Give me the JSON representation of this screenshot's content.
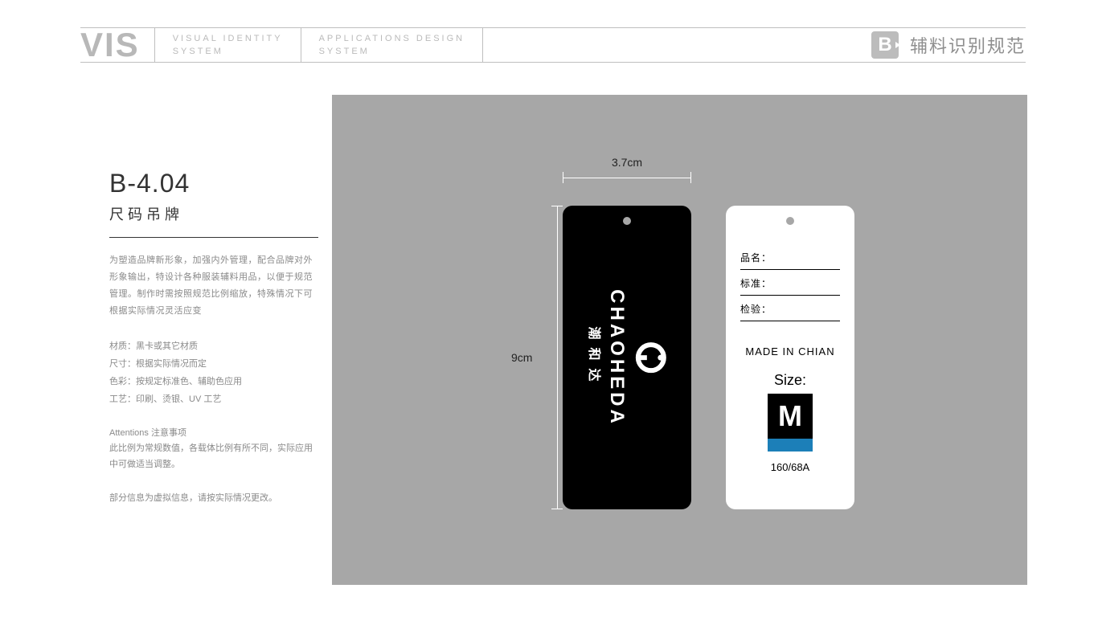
{
  "header": {
    "vis": "VIS",
    "block1_l1": "VISUAL IDENTITY",
    "block1_l2": "SYSTEM",
    "block2_l1": "APPLICATIONS DESIGN",
    "block2_l2": "SYSTEM",
    "badge": "B",
    "section": "辅料识别规范"
  },
  "left": {
    "code": "B-4.04",
    "title": "尺码吊牌",
    "intro": "为塑造品牌新形象，加强内外管理，配合品牌对外形象输出，特设计各种服装辅料用品，以便于规范管理。制作时需按照规范比例缩放，特殊情况下可根据实际情况灵活应变",
    "specs": {
      "material": "材质：黑卡或其它材质",
      "size": "尺寸：根据实际情况而定",
      "color": "色彩：按规定标准色、辅助色应用",
      "craft": "工艺：印刷、烫银、UV 工艺"
    },
    "notes_head": "Attentions 注意事项",
    "notes_body": "此比例为常规数值，各载体比例有所不同，实际应用中可做适当调整。",
    "footnote": "部分信息为虚拟信息，请按实际情况更改。"
  },
  "dims": {
    "width": "3.7cm",
    "height": "9cm"
  },
  "tag_front": {
    "brand_en": "CHAOHEDA",
    "brand_cn": "潮和达"
  },
  "tag_back": {
    "field_name": "品名：",
    "field_std": "标准：",
    "field_check": "检验：",
    "origin": "MADE IN CHIAN",
    "size_label": "Size:",
    "size_letter": "M",
    "size_code": "160/68A"
  }
}
